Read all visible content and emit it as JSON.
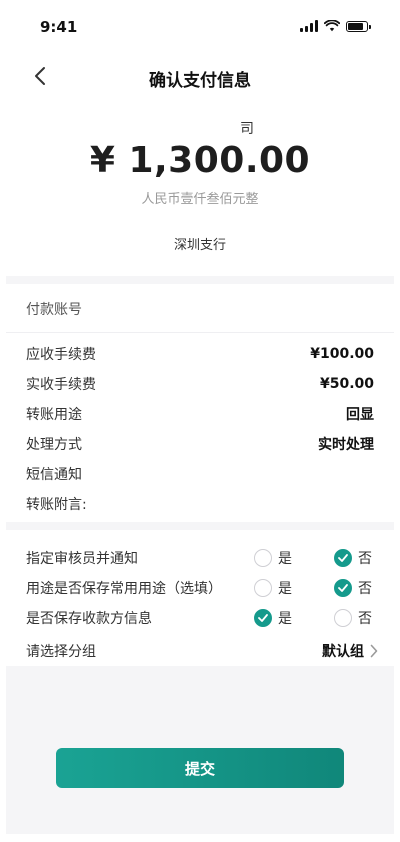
{
  "status_bar": {
    "time": "9:41",
    "icons": [
      "signal-icon",
      "wifi-icon",
      "battery-icon"
    ]
  },
  "nav": {
    "title": "确认支付信息",
    "back_icon": "chevron-left-icon"
  },
  "payee": {
    "name_visible": "司",
    "amount": "¥ 1,300.00",
    "amount_in_words": "人民币壹仟叁佰元整",
    "branch": "深圳支行"
  },
  "details": {
    "pay_account_label": "付款账号",
    "rows": [
      {
        "label": "应收手续费",
        "value": "¥100.00"
      },
      {
        "label": "实收手续费",
        "value": "¥50.00"
      },
      {
        "label": "转账用途",
        "value": "回显"
      },
      {
        "label": "处理方式",
        "value": "实时处理"
      },
      {
        "label": "短信通知",
        "value": ""
      },
      {
        "label": "转账附言:",
        "value": ""
      }
    ]
  },
  "options": {
    "yes_label": "是",
    "no_label": "否",
    "rows": [
      {
        "label": "指定审核员并通知",
        "selected": "no"
      },
      {
        "label": "用途是否保存常用用途（选填）",
        "selected": "no"
      },
      {
        "label": "是否保存收款方信息",
        "selected": "yes"
      }
    ],
    "group": {
      "label": "请选择分组",
      "value": "默认组",
      "icon": "chevron-right-icon"
    }
  },
  "submit_label": "提交",
  "colors": {
    "accent": "#159a8c",
    "page_bg": "#f5f5f7",
    "card_bg": "#ffffff"
  }
}
